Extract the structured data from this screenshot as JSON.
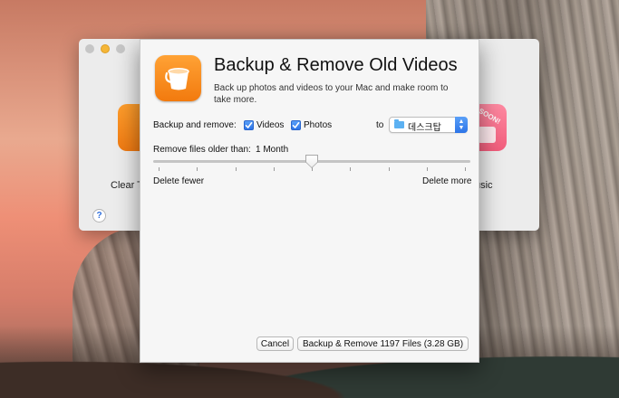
{
  "background_window": {
    "left_app_label": "Clear T",
    "right_app_label": "usic",
    "right_app_badge": "SOON!",
    "help_label": "?"
  },
  "dialog": {
    "title": "Backup & Remove Old Videos",
    "subtitle": "Back up photos and videos to your Mac and make room to take more.",
    "backup_and_remove_label": "Backup and remove:",
    "videos_label": "Videos",
    "videos_checked": true,
    "photos_label": "Photos",
    "photos_checked": true,
    "to_label": "to",
    "destination": "데스크탑",
    "remove_older_label": "Remove files older than:",
    "age_value": "1 Month",
    "slider_ticks": 9,
    "slider_position_index": 4,
    "delete_fewer_label": "Delete fewer",
    "delete_more_label": "Delete more",
    "cancel_label": "Cancel",
    "confirm_label": "Backup & Remove 1197 Files (3.28 GB)"
  },
  "colors": {
    "accent": "#2c74e8",
    "app_icon": "#f27a0e",
    "sheet_bg": "#f6f6f6"
  }
}
